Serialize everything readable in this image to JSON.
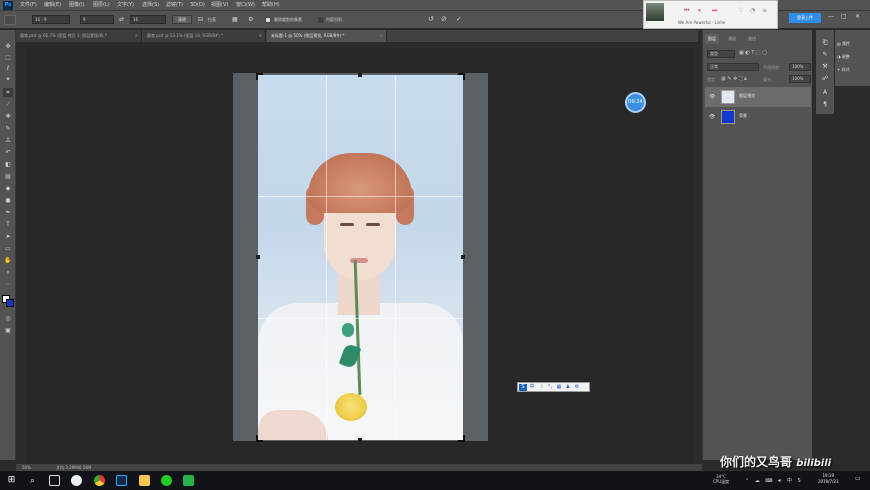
{
  "menubar": {
    "logo": "Ps",
    "items": [
      "文件(F)",
      "编辑(E)",
      "图像(I)",
      "图层(L)",
      "文字(Y)",
      "选择(S)",
      "滤镜(T)",
      "3D(D)",
      "视图(V)",
      "窗口(W)",
      "帮助(H)"
    ]
  },
  "options": {
    "ratio_select": "16 : 9",
    "width_value": "9",
    "swap_icon": "⇄",
    "height_value": "16",
    "clear_button": "清除",
    "straighten_label": "拉直",
    "delete_cropped_label": "删除裁剪的像素",
    "content_aware_label": "内容识别"
  },
  "tabs": [
    {
      "label": "圆笔.psd @ 66.7% (图层 拷贝 1, 图层蒙版/8) *"
    },
    {
      "label": "圆笔.psd @ 53.1% (图层 16, RGB/8#) *"
    },
    {
      "label": "未标题-1 @ 50% (图层预览, RGB/8#) *"
    }
  ],
  "timer_badge": "00:24",
  "music": {
    "song": "We Are Powerful · Linhe"
  },
  "login_button": "登录上传",
  "layers_panel": {
    "tabs": [
      "图层",
      "通道",
      "路径"
    ],
    "kind_filter": "类型",
    "blend_mode": "正常",
    "opacity_label": "不透明度:",
    "opacity_value": "100%",
    "lock_label": "锁定:",
    "fill_label": "填充:",
    "fill_value": "100%",
    "layers": [
      {
        "name": "图层预览",
        "selected": true
      },
      {
        "name": "背景",
        "selected": false
      }
    ]
  },
  "props_panel": {
    "items": [
      "属性",
      "调整",
      "样式"
    ]
  },
  "status": {
    "zoom": "50%",
    "doc_info": "文档:3.29M/6.58M"
  },
  "ime": {
    "items": [
      "中",
      "☽",
      "°,",
      "▦",
      "♟",
      "⚙"
    ]
  },
  "tray": {
    "temp": "34°C",
    "cpu_label": "CPU温度",
    "time": "19:19",
    "date": "2019/7/23"
  },
  "watermark": "你们的又鸟哥",
  "watermark_site": "bilibili",
  "colors": {
    "accent": "#31a8ff",
    "photo_bg": "#c9dcef",
    "layer_bg_thumb": "#1339c9"
  }
}
